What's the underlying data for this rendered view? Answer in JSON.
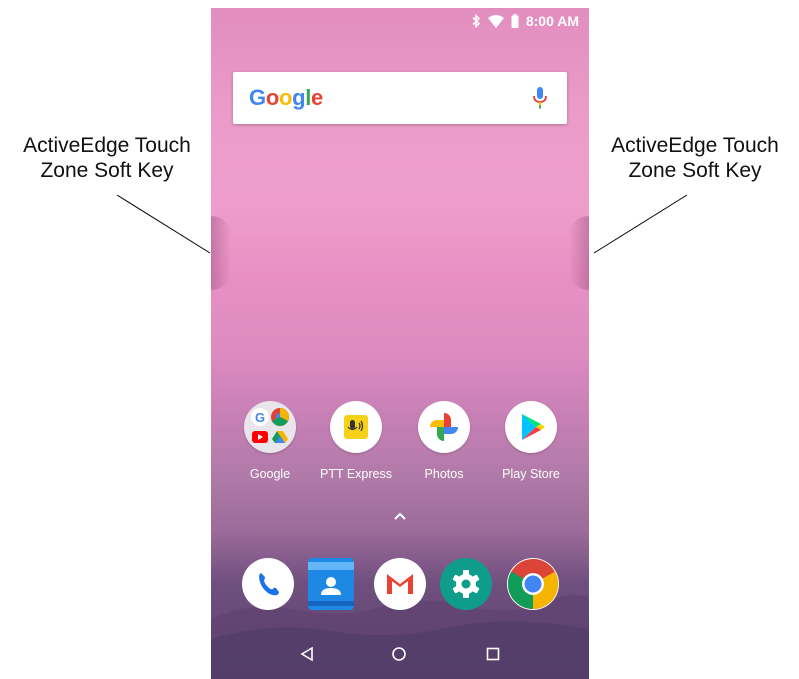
{
  "callouts": {
    "left": {
      "line1": "ActiveEdge Touch",
      "line2": "Zone Soft Key"
    },
    "right": {
      "line1": "ActiveEdge Touch",
      "line2": "Zone Soft Key"
    }
  },
  "status_bar": {
    "time": "8:00 AM",
    "icons": [
      "bluetooth-icon",
      "wifi-icon",
      "battery-icon"
    ]
  },
  "search": {
    "logo_letters": [
      {
        "char": "G",
        "color": "#4285F4"
      },
      {
        "char": "o",
        "color": "#EA4335"
      },
      {
        "char": "o",
        "color": "#FBBC05"
      },
      {
        "char": "g",
        "color": "#4285F4"
      },
      {
        "char": "l",
        "color": "#34A853"
      },
      {
        "char": "e",
        "color": "#EA4335"
      }
    ],
    "mic_icon": "mic-icon"
  },
  "apps": [
    {
      "label": "Google",
      "icon": "google-folder-icon"
    },
    {
      "label": "PTT Express",
      "icon": "ptt-express-icon"
    },
    {
      "label": "Photos",
      "icon": "photos-icon"
    },
    {
      "label": "Play Store",
      "icon": "play-store-icon"
    }
  ],
  "dock": [
    {
      "name": "phone-icon"
    },
    {
      "name": "contacts-icon"
    },
    {
      "name": "gmail-icon"
    },
    {
      "name": "settings-icon"
    },
    {
      "name": "chrome-icon"
    }
  ],
  "navigation": [
    "back-button",
    "home-button",
    "recents-button"
  ],
  "colors": {
    "wallpaper_top": "#e28dbe",
    "wallpaper_bottom": "#5e4871"
  }
}
